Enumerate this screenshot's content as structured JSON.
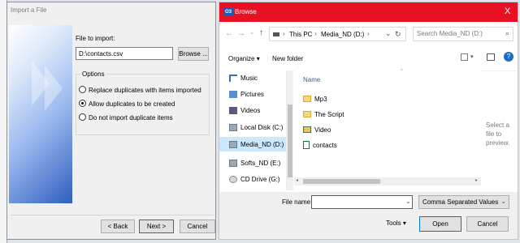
{
  "import_dialog": {
    "title": "Import a File",
    "file_to_import_label": "File to import:",
    "file_path": "D:\\contacts.csv",
    "browse_label": "Browse ...",
    "options_label": "Options",
    "options": [
      {
        "label": "Replace duplicates with items imported",
        "selected": false
      },
      {
        "label": "Allow duplicates to be created",
        "selected": true
      },
      {
        "label": "Do not import duplicate items",
        "selected": false
      }
    ],
    "back_label": "< Back",
    "next_label": "Next >",
    "cancel_label": "Cancel"
  },
  "browse_dialog": {
    "app_icon_text": "O3",
    "title": "Browse",
    "close_label": "X",
    "breadcrumb": [
      "This PC",
      "Media_ND (D:)"
    ],
    "search_placeholder": "Search Media_ND (D:)",
    "organize_label": "Organize",
    "new_folder_label": "New folder",
    "nav_items": [
      {
        "label": "Music",
        "icon": "music-icon"
      },
      {
        "label": "Pictures",
        "icon": "pictures-icon"
      },
      {
        "label": "Videos",
        "icon": "videos-icon"
      },
      {
        "label": "Local Disk (C:)",
        "icon": "drive-icon"
      },
      {
        "label": "Media_ND (D:)",
        "icon": "drive-icon",
        "selected": true
      },
      {
        "label": "Softs_ND (E:)",
        "icon": "drive-icon"
      },
      {
        "label": "CD Drive (G:)",
        "icon": "cd-drive-icon"
      }
    ],
    "column_name": "Name",
    "files": [
      {
        "label": "Mp3",
        "icon": "folder-icon"
      },
      {
        "label": "The Script",
        "icon": "folder-icon"
      },
      {
        "label": "Video",
        "icon": "video-folder-icon"
      },
      {
        "label": "contacts",
        "icon": "csv-file-icon"
      }
    ],
    "preview_text": "Select a file to preview.",
    "file_name_label": "File name:",
    "file_name_value": "",
    "filter_value": "Comma Separated Values",
    "tools_label": "Tools",
    "open_label": "Open",
    "cancel_label": "Cancel"
  },
  "colors": {
    "title_bar": "#e81123",
    "selection": "#cce8ff",
    "accent": "#0078d7"
  }
}
